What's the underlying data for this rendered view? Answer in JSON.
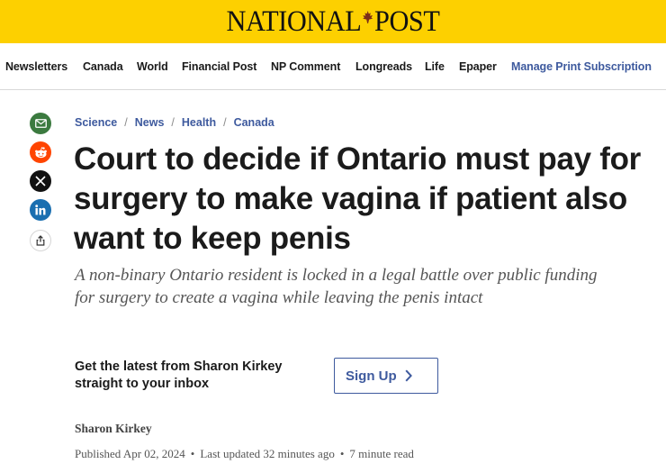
{
  "masthead": {
    "logo_left": "NATIONAL",
    "logo_right": "POST",
    "icon": "maple-leaf-icon",
    "background": "#fdd000"
  },
  "nav": {
    "items": [
      "Newsletters",
      "Canada",
      "World",
      "Financial Post",
      "NP Comment",
      "Longreads",
      "Life",
      "Epaper"
    ],
    "manage_link": "Manage Print Subscription",
    "accent_color": "#3e5a9e"
  },
  "share": {
    "icons": [
      "email-icon",
      "reddit-icon",
      "x-icon",
      "linkedin-icon",
      "share-icon"
    ]
  },
  "breadcrumbs": [
    "Science",
    "News",
    "Health",
    "Canada"
  ],
  "article": {
    "headline": "Court to decide if Ontario must pay for surgery to make vagina if patient also want to keep penis",
    "dek": "A non-binary Ontario resident is locked in a legal battle over public funding for surgery to create a vagina while leaving the penis intact",
    "author": "Sharon Kirkey",
    "published": "Published Apr 02, 2024",
    "updated": "Last updated 32 minutes ago",
    "read_time": "7 minute read"
  },
  "newsletter": {
    "prompt": "Get the latest from Sharon Kirkey straight to your inbox",
    "button_label": "Sign Up"
  }
}
